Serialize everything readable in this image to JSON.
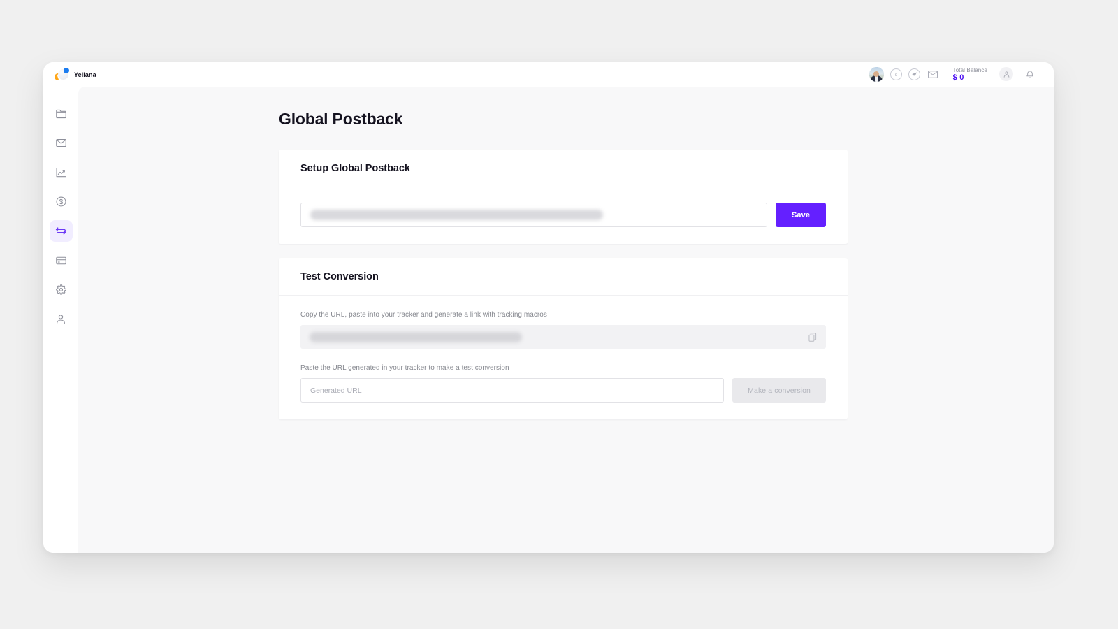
{
  "brand": {
    "name": "Yellana"
  },
  "topbar": {
    "avatar_alt": "user-avatar",
    "icons": [
      "skype-icon",
      "telegram-icon",
      "mail-icon"
    ],
    "balance_label": "Total Balance",
    "balance_value": "$ 0",
    "account_icon": "user-circle-icon",
    "notifications_icon": "bell-icon"
  },
  "sidebar": {
    "items": [
      {
        "name": "sidebar-item-offers",
        "icon": "folder-icon",
        "active": false
      },
      {
        "name": "sidebar-item-messages",
        "icon": "mail-icon",
        "active": false
      },
      {
        "name": "sidebar-item-statistics",
        "icon": "chart-icon",
        "active": false
      },
      {
        "name": "sidebar-item-finances",
        "icon": "dollar-circle-icon",
        "active": false
      },
      {
        "name": "sidebar-item-postback",
        "icon": "exchange-arrows-icon",
        "active": true
      },
      {
        "name": "sidebar-item-payments",
        "icon": "card-icon",
        "active": false
      },
      {
        "name": "sidebar-item-settings",
        "icon": "gear-icon",
        "active": false
      },
      {
        "name": "sidebar-item-profile",
        "icon": "person-icon",
        "active": false
      }
    ]
  },
  "page": {
    "title": "Global Postback"
  },
  "setup_card": {
    "title": "Setup Global Postback",
    "postback_url_value": "https://demo-ru.keitaro.io/?acfd7/postback?status={status}&subid={get_subid}&payout={amount}",
    "postback_url_placeholder": "",
    "save_label": "Save"
  },
  "test_card": {
    "title": "Test Conversion",
    "copy_hint": "Copy the URL, paste into your tracker and generate a link with tracking macros",
    "test_url_value": "https://app.yellana.io/test-conversion?userid=33932&cid={CLICK_ID}",
    "copy_icon": "copy-icon",
    "paste_hint": "Paste the URL generated in your tracker to make a test conversion",
    "generated_url_placeholder": "Generated URL",
    "generated_url_value": "",
    "make_conversion_label": "Make a conversion"
  },
  "colors": {
    "accent": "#6420ff",
    "accent_soft": "#f1edff",
    "balance": "#4a0df2",
    "page_bg": "#f0f0f0",
    "content_bg": "#f8f8f9",
    "card_bg": "#ffffff"
  }
}
